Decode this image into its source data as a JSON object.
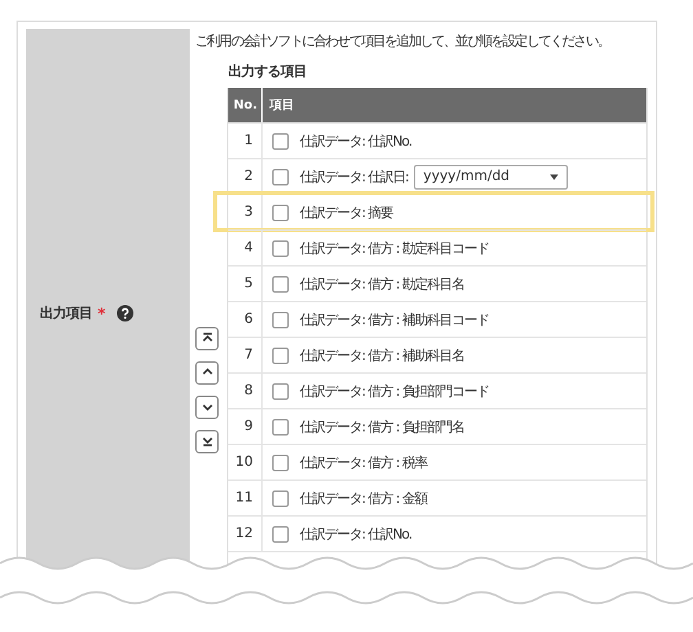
{
  "field": {
    "label": "出力項目",
    "required_mark": "*",
    "has_help": true
  },
  "description": "ご利用の会計ソフトに合わせて項目を追加して、並び順を設定してください。",
  "heading": "出力する項目",
  "order_buttons": [
    {
      "kind": "top"
    },
    {
      "kind": "up"
    },
    {
      "kind": "down"
    },
    {
      "kind": "bottom"
    }
  ],
  "table": {
    "columns": [
      "No.",
      "項目"
    ],
    "rows": [
      {
        "no": "1",
        "label": "仕訳データ: 仕訳No.",
        "checked": false,
        "selected": false,
        "kind": "checkbox"
      },
      {
        "no": "2",
        "label": "仕訳データ: 仕訳日:",
        "checked": false,
        "selected": false,
        "kind": "date_select",
        "select_value": "yyyy/mm/dd"
      },
      {
        "no": "3",
        "label": "仕訳データ: 摘要",
        "checked": false,
        "selected": true,
        "kind": "checkbox"
      },
      {
        "no": "4",
        "label": "仕訳データ: 借方 : 勘定科目コード",
        "checked": false,
        "selected": false,
        "kind": "checkbox"
      },
      {
        "no": "5",
        "label": "仕訳データ: 借方 : 勘定科目名",
        "checked": false,
        "selected": false,
        "kind": "checkbox"
      },
      {
        "no": "6",
        "label": "仕訳データ: 借方 : 補助科目コード",
        "checked": false,
        "selected": false,
        "kind": "checkbox"
      },
      {
        "no": "7",
        "label": "仕訳データ: 借方 : 補助科目名",
        "checked": false,
        "selected": false,
        "kind": "checkbox"
      },
      {
        "no": "8",
        "label": "仕訳データ: 借方 : 負担部門コード",
        "checked": false,
        "selected": false,
        "kind": "checkbox"
      },
      {
        "no": "9",
        "label": "仕訳データ: 借方 : 負担部門名",
        "checked": false,
        "selected": false,
        "kind": "checkbox"
      },
      {
        "no": "10",
        "label": "仕訳データ: 借方 : 税率",
        "checked": false,
        "selected": false,
        "kind": "checkbox"
      },
      {
        "no": "11",
        "label": "仕訳データ: 借方 : 金額",
        "checked": false,
        "selected": false,
        "kind": "checkbox"
      },
      {
        "no": "12",
        "label": "仕訳データ: 仕訳No.",
        "checked": false,
        "selected": false,
        "kind": "checkbox"
      }
    ]
  }
}
